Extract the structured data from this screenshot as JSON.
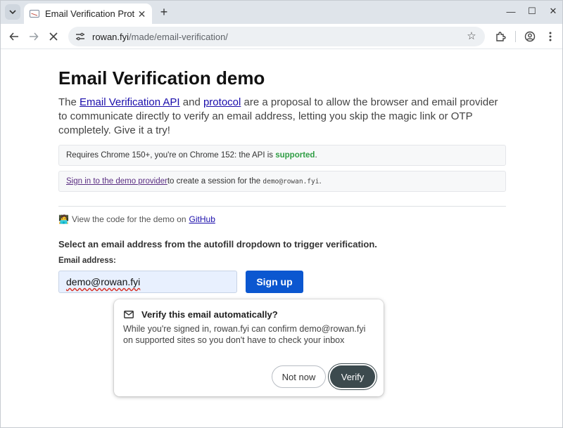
{
  "browser": {
    "tab_title": "Email Verification Protocol",
    "url_host": "rowan.fyi",
    "url_path": "/made/email-verification/"
  },
  "page": {
    "title": "Email Verification demo",
    "intro": {
      "prefix": "The ",
      "api_link": "Email Verification API",
      "and": " and ",
      "protocol_link": "protocol",
      "rest": " are a proposal to allow the browser and email provider to communicate directly to verify an email address, letting you skip the magic link or OTP completely. Give it a try!"
    },
    "support_note": {
      "text": "Requires Chrome 150+, you're on Chrome 152: the API is ",
      "status": "supported",
      "end": "."
    },
    "signin_note": {
      "link": "Sign in to the demo provider",
      "text": " to create a session for the ",
      "email": "demo@rowan.fyi",
      "end": "."
    },
    "code_line": {
      "emoji": "🧑‍💻",
      "text": "View the code for the demo on",
      "link": "GitHub"
    },
    "instruction": "Select an email address from the autofill dropdown to trigger verification.",
    "email_label": "Email address:",
    "email_value": "demo@rowan.fyi",
    "signup_label": "Sign up"
  },
  "popup": {
    "title": "Verify this email automatically?",
    "body": "While you're signed in, rowan.fyi can confirm demo@rowan.fyi on supported sites so you don't have to check your inbox",
    "not_now": "Not now",
    "verify": "Verify"
  }
}
